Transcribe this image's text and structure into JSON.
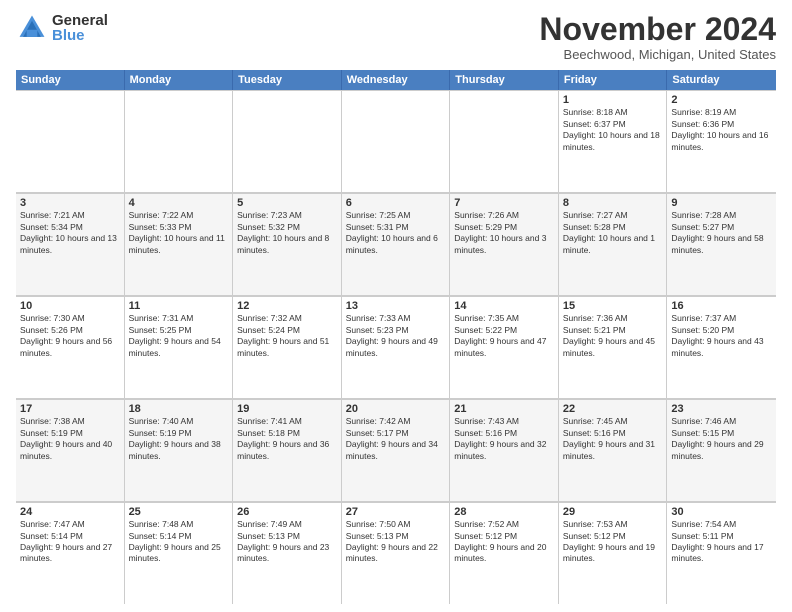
{
  "logo": {
    "general": "General",
    "blue": "Blue"
  },
  "title": "November 2024",
  "location": "Beechwood, Michigan, United States",
  "header_days": [
    "Sunday",
    "Monday",
    "Tuesday",
    "Wednesday",
    "Thursday",
    "Friday",
    "Saturday"
  ],
  "weeks": [
    [
      {
        "day": "",
        "info": ""
      },
      {
        "day": "",
        "info": ""
      },
      {
        "day": "",
        "info": ""
      },
      {
        "day": "",
        "info": ""
      },
      {
        "day": "",
        "info": ""
      },
      {
        "day": "1",
        "sunrise": "Sunrise: 8:18 AM",
        "sunset": "Sunset: 6:37 PM",
        "daylight": "Daylight: 10 hours and 18 minutes."
      },
      {
        "day": "2",
        "sunrise": "Sunrise: 8:19 AM",
        "sunset": "Sunset: 6:36 PM",
        "daylight": "Daylight: 10 hours and 16 minutes."
      }
    ],
    [
      {
        "day": "3",
        "sunrise": "Sunrise: 7:21 AM",
        "sunset": "Sunset: 5:34 PM",
        "daylight": "Daylight: 10 hours and 13 minutes."
      },
      {
        "day": "4",
        "sunrise": "Sunrise: 7:22 AM",
        "sunset": "Sunset: 5:33 PM",
        "daylight": "Daylight: 10 hours and 11 minutes."
      },
      {
        "day": "5",
        "sunrise": "Sunrise: 7:23 AM",
        "sunset": "Sunset: 5:32 PM",
        "daylight": "Daylight: 10 hours and 8 minutes."
      },
      {
        "day": "6",
        "sunrise": "Sunrise: 7:25 AM",
        "sunset": "Sunset: 5:31 PM",
        "daylight": "Daylight: 10 hours and 6 minutes."
      },
      {
        "day": "7",
        "sunrise": "Sunrise: 7:26 AM",
        "sunset": "Sunset: 5:29 PM",
        "daylight": "Daylight: 10 hours and 3 minutes."
      },
      {
        "day": "8",
        "sunrise": "Sunrise: 7:27 AM",
        "sunset": "Sunset: 5:28 PM",
        "daylight": "Daylight: 10 hours and 1 minute."
      },
      {
        "day": "9",
        "sunrise": "Sunrise: 7:28 AM",
        "sunset": "Sunset: 5:27 PM",
        "daylight": "Daylight: 9 hours and 58 minutes."
      }
    ],
    [
      {
        "day": "10",
        "sunrise": "Sunrise: 7:30 AM",
        "sunset": "Sunset: 5:26 PM",
        "daylight": "Daylight: 9 hours and 56 minutes."
      },
      {
        "day": "11",
        "sunrise": "Sunrise: 7:31 AM",
        "sunset": "Sunset: 5:25 PM",
        "daylight": "Daylight: 9 hours and 54 minutes."
      },
      {
        "day": "12",
        "sunrise": "Sunrise: 7:32 AM",
        "sunset": "Sunset: 5:24 PM",
        "daylight": "Daylight: 9 hours and 51 minutes."
      },
      {
        "day": "13",
        "sunrise": "Sunrise: 7:33 AM",
        "sunset": "Sunset: 5:23 PM",
        "daylight": "Daylight: 9 hours and 49 minutes."
      },
      {
        "day": "14",
        "sunrise": "Sunrise: 7:35 AM",
        "sunset": "Sunset: 5:22 PM",
        "daylight": "Daylight: 9 hours and 47 minutes."
      },
      {
        "day": "15",
        "sunrise": "Sunrise: 7:36 AM",
        "sunset": "Sunset: 5:21 PM",
        "daylight": "Daylight: 9 hours and 45 minutes."
      },
      {
        "day": "16",
        "sunrise": "Sunrise: 7:37 AM",
        "sunset": "Sunset: 5:20 PM",
        "daylight": "Daylight: 9 hours and 43 minutes."
      }
    ],
    [
      {
        "day": "17",
        "sunrise": "Sunrise: 7:38 AM",
        "sunset": "Sunset: 5:19 PM",
        "daylight": "Daylight: 9 hours and 40 minutes."
      },
      {
        "day": "18",
        "sunrise": "Sunrise: 7:40 AM",
        "sunset": "Sunset: 5:19 PM",
        "daylight": "Daylight: 9 hours and 38 minutes."
      },
      {
        "day": "19",
        "sunrise": "Sunrise: 7:41 AM",
        "sunset": "Sunset: 5:18 PM",
        "daylight": "Daylight: 9 hours and 36 minutes."
      },
      {
        "day": "20",
        "sunrise": "Sunrise: 7:42 AM",
        "sunset": "Sunset: 5:17 PM",
        "daylight": "Daylight: 9 hours and 34 minutes."
      },
      {
        "day": "21",
        "sunrise": "Sunrise: 7:43 AM",
        "sunset": "Sunset: 5:16 PM",
        "daylight": "Daylight: 9 hours and 32 minutes."
      },
      {
        "day": "22",
        "sunrise": "Sunrise: 7:45 AM",
        "sunset": "Sunset: 5:16 PM",
        "daylight": "Daylight: 9 hours and 31 minutes."
      },
      {
        "day": "23",
        "sunrise": "Sunrise: 7:46 AM",
        "sunset": "Sunset: 5:15 PM",
        "daylight": "Daylight: 9 hours and 29 minutes."
      }
    ],
    [
      {
        "day": "24",
        "sunrise": "Sunrise: 7:47 AM",
        "sunset": "Sunset: 5:14 PM",
        "daylight": "Daylight: 9 hours and 27 minutes."
      },
      {
        "day": "25",
        "sunrise": "Sunrise: 7:48 AM",
        "sunset": "Sunset: 5:14 PM",
        "daylight": "Daylight: 9 hours and 25 minutes."
      },
      {
        "day": "26",
        "sunrise": "Sunrise: 7:49 AM",
        "sunset": "Sunset: 5:13 PM",
        "daylight": "Daylight: 9 hours and 23 minutes."
      },
      {
        "day": "27",
        "sunrise": "Sunrise: 7:50 AM",
        "sunset": "Sunset: 5:13 PM",
        "daylight": "Daylight: 9 hours and 22 minutes."
      },
      {
        "day": "28",
        "sunrise": "Sunrise: 7:52 AM",
        "sunset": "Sunset: 5:12 PM",
        "daylight": "Daylight: 9 hours and 20 minutes."
      },
      {
        "day": "29",
        "sunrise": "Sunrise: 7:53 AM",
        "sunset": "Sunset: 5:12 PM",
        "daylight": "Daylight: 9 hours and 19 minutes."
      },
      {
        "day": "30",
        "sunrise": "Sunrise: 7:54 AM",
        "sunset": "Sunset: 5:11 PM",
        "daylight": "Daylight: 9 hours and 17 minutes."
      }
    ]
  ],
  "alt_rows": [
    1,
    3
  ]
}
